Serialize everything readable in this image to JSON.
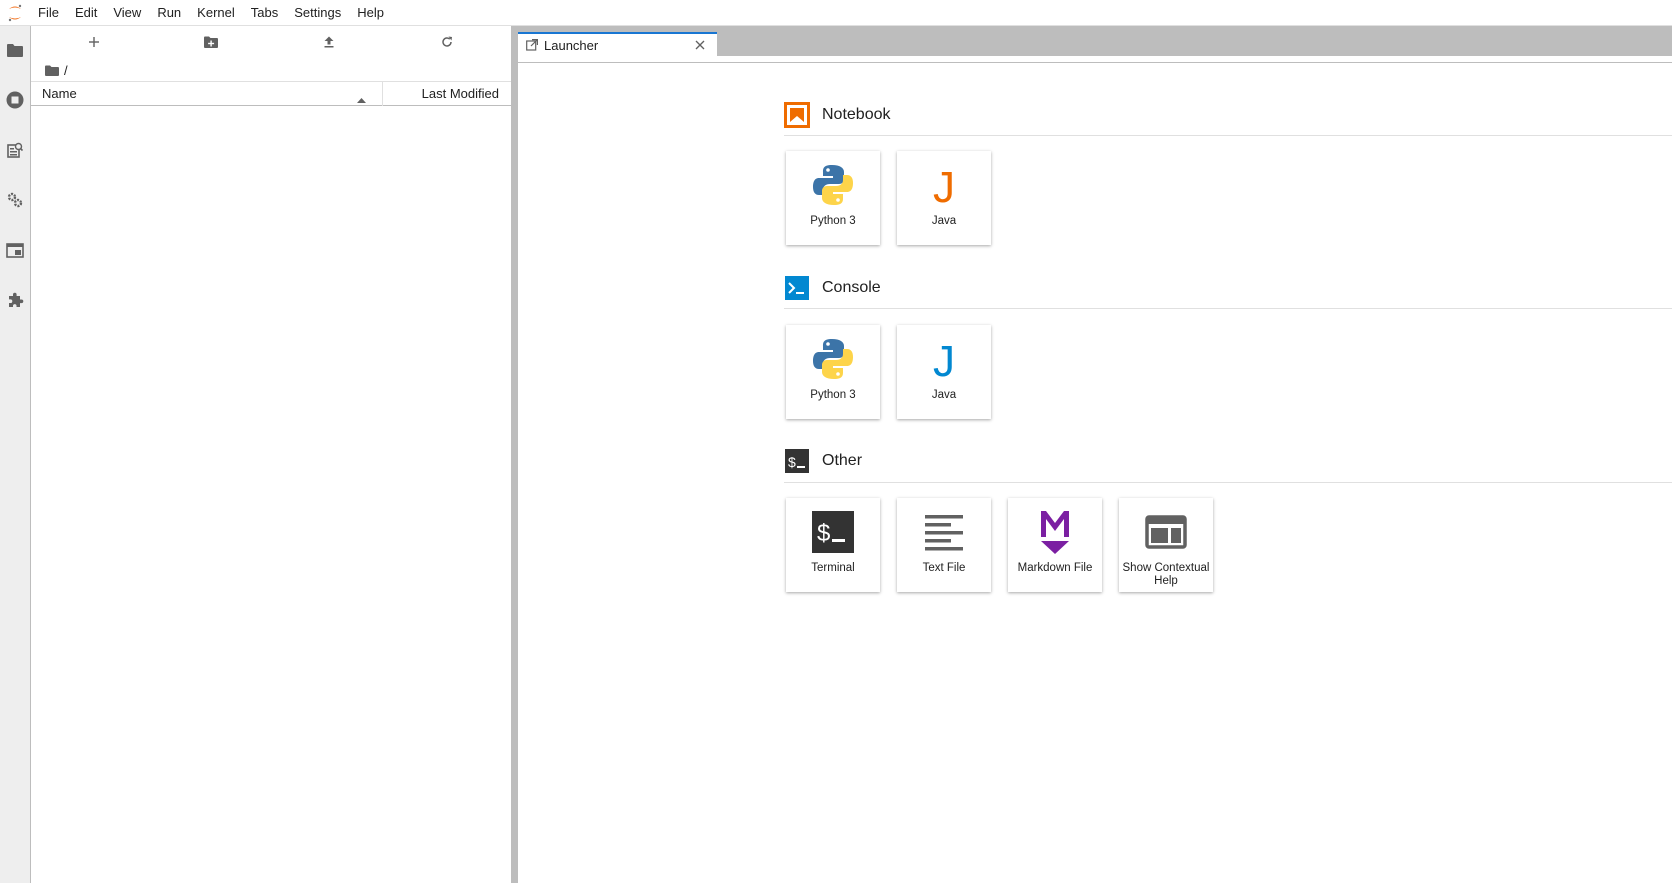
{
  "menubar": {
    "items": [
      "File",
      "Edit",
      "View",
      "Run",
      "Kernel",
      "Tabs",
      "Settings",
      "Help"
    ]
  },
  "leftbar": {
    "icons": [
      "folder-icon",
      "running-icon",
      "commands-icon",
      "property-inspector-icon",
      "tabs-icon",
      "extension-icon"
    ]
  },
  "filebrowser": {
    "breadcrumb": "/",
    "columns": {
      "name": "Name",
      "last_modified": "Last Modified"
    },
    "items": []
  },
  "dock": {
    "tab_label": "Launcher"
  },
  "launcher": {
    "sections": [
      {
        "title": "Notebook",
        "cards": [
          {
            "label": "Python 3"
          },
          {
            "label": "Java"
          }
        ]
      },
      {
        "title": "Console",
        "cards": [
          {
            "label": "Python 3"
          },
          {
            "label": "Java"
          }
        ]
      },
      {
        "title": "Other",
        "cards": [
          {
            "label": "Terminal"
          },
          {
            "label": "Text File"
          },
          {
            "label": "Markdown File"
          },
          {
            "label": "Show Contextual Help"
          }
        ]
      }
    ]
  },
  "colors": {
    "accent": "#1976d2",
    "notebook": "#ef6c00",
    "console": "#0288d1",
    "other": "#333333",
    "markdown": "#7b1fa2",
    "python_blue": "#3c74a8",
    "python_yellow": "#fdd44a"
  }
}
